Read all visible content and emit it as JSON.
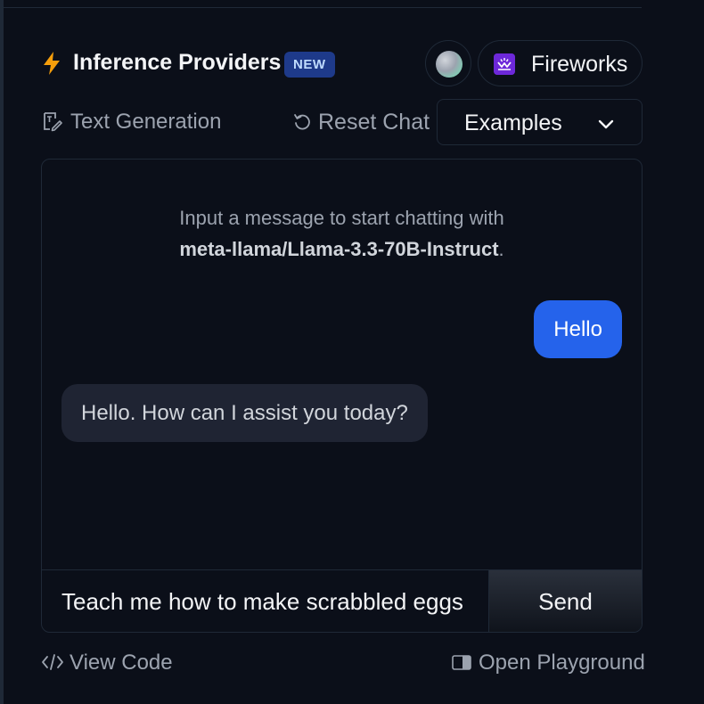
{
  "header": {
    "title": "Inference Providers",
    "badge": "NEW",
    "provider": "Fireworks"
  },
  "toolbar": {
    "task": "Text Generation",
    "reset_label": "Reset Chat",
    "examples_label": "Examples"
  },
  "chat": {
    "intro_text": "Input a message to start chatting with",
    "model_name": "meta-llama/Llama-3.3-70B-Instruct",
    "intro_suffix": ".",
    "messages": [
      {
        "role": "user",
        "text": "Hello"
      },
      {
        "role": "assistant",
        "text": "Hello. How can I assist you today?"
      }
    ],
    "input_value": "Teach me how to make scrabbled eggs",
    "send_label": "Send"
  },
  "footer": {
    "view_code": "View Code",
    "open_playground": "Open Playground"
  },
  "colors": {
    "background": "#0b0f19",
    "accent_blue": "#2563eb",
    "badge_bg": "#1e3a8a",
    "bolt": "#f59e0b",
    "fireworks_logo": "#6d28d9"
  },
  "icons": [
    "bolt-icon",
    "avatar-icon",
    "fireworks-logo-icon",
    "text-generation-icon",
    "reset-icon",
    "chevron-down-icon",
    "code-icon",
    "open-playground-icon"
  ]
}
